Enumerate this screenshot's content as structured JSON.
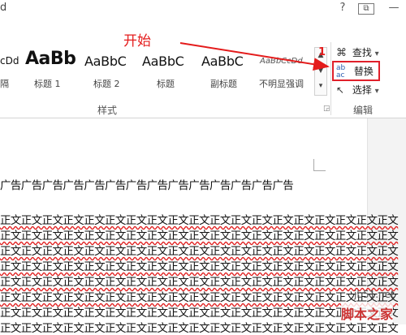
{
  "window": {
    "title_fragment": "d",
    "help": "?",
    "restore": "⧉",
    "minimize": "—"
  },
  "annotations": {
    "start": "开始",
    "step_one": "1"
  },
  "styles": {
    "items": [
      {
        "preview": "cDd",
        "label": "隔"
      },
      {
        "preview": "AaBb",
        "label": "标题 1"
      },
      {
        "preview": "AaBbC",
        "label": "标题 2"
      },
      {
        "preview": "AaBbC",
        "label": "标题"
      },
      {
        "preview": "AaBbC",
        "label": "副标题"
      },
      {
        "preview": "AaBbCcDd",
        "label": "不明显强调"
      }
    ],
    "group_label": "样式",
    "scroll_up": "▲",
    "scroll_down": "▼",
    "more": "▾"
  },
  "editing": {
    "find": {
      "icon": "binoculars-icon",
      "label": "查找",
      "caret": "▾"
    },
    "replace": {
      "icon": "replace-icon",
      "label": "替换"
    },
    "select": {
      "icon": "select-arrow-icon",
      "label": "选择",
      "caret": "▾"
    },
    "group_label": "编辑"
  },
  "document": {
    "line_ad": "广告广告广告广告广告广告广告广告广告广告广告广告广告广告",
    "body_lines": [
      "正文正文正文正文正文正文正文正文正文正文正文正文正文正文正文正文正文正文正文",
      "正文正文正文正文正文正文正文正文正文正文正文正文正文正文正文正文正文正文正文",
      "正文正文正文正文正文正文正文正文正文正文正文正文正文正文正文正文正文正文正文",
      "正文正文正文正文正文正文正文正文正文正文正文正文正文正文正文正文正文正文正文",
      "正文正文正文正文正文正文正文正文正文正文正文正文正文正文正文正文正文正文正文",
      "正文正文正文正文正文正文正文正文正文正文正文正文正文正文正文正文正文正文正文",
      "正文正文正文正文正文正文正文正文正文正文正文正文正文正文正文正文正文正文正文",
      "正文正文正文正文正文正文正文正文正文正文正文正文正文正文正文正文正文正文正文"
    ]
  },
  "watermark": {
    "url": "jb51.net",
    "brand": "脚本之家"
  },
  "colors": {
    "annotation_red": "#e41b1b"
  }
}
